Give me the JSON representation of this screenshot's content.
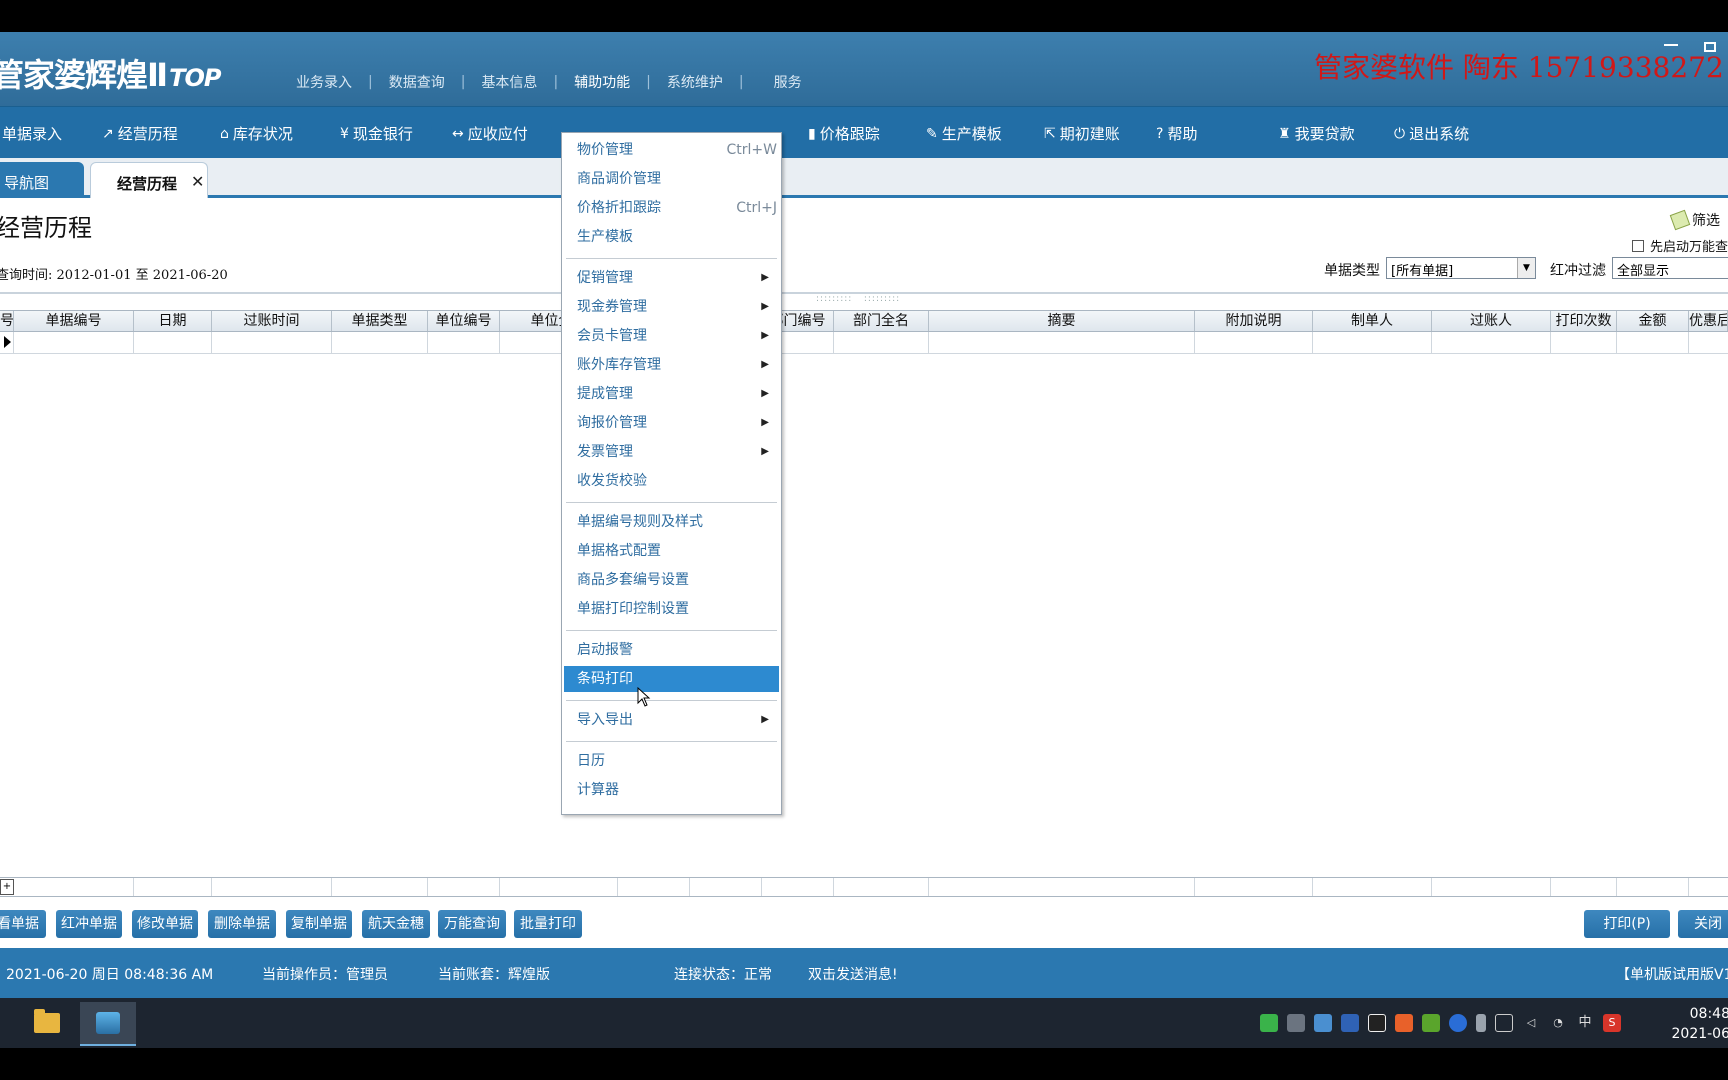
{
  "header": {
    "logo_text": "管家婆",
    "logo_sub": "辉煌Ⅱ",
    "logo_top": "TOP",
    "menu": [
      "业务录入",
      "数据查询",
      "基本信息",
      "辅助功能",
      "系统维护",
      "服务"
    ],
    "brand_contact": "管家婆软件 陶东 15719338272"
  },
  "toolbar": {
    "items": [
      {
        "label": "单据录入",
        "icon": "list-icon"
      },
      {
        "label": "经营历程",
        "icon": "chart-line-icon"
      },
      {
        "label": "库存状况",
        "icon": "home-icon"
      },
      {
        "label": "现金银行",
        "icon": "yen-icon"
      },
      {
        "label": "应收应付",
        "icon": "arrows-icon"
      },
      {
        "label": "价格跟踪",
        "icon": "bar-chart-icon"
      },
      {
        "label": "生产模板",
        "icon": "wrench-icon"
      },
      {
        "label": "期初建账",
        "icon": "external-icon"
      },
      {
        "label": "帮助",
        "icon": "question-icon"
      },
      {
        "label": "我要贷款",
        "icon": "money-bag-icon"
      },
      {
        "label": "退出系统",
        "icon": "power-icon"
      }
    ]
  },
  "tabs": {
    "nav": "导航图",
    "active": "经营历程",
    "close": "✕"
  },
  "content": {
    "title": "经营历程",
    "query_label": "查询时间:",
    "date_from": "2012-01-01",
    "date_to_label": "至",
    "date_to": "2021-06-20",
    "filter": "筛选",
    "auto_check": "先启动万能查",
    "doc_type_label": "单据类型",
    "doc_type_value": "[所有单据]",
    "red_filter_label": "红冲过滤",
    "red_filter_value": "全部显示"
  },
  "grid": {
    "columns": [
      "号",
      "单据编号",
      "日期",
      "过账时间",
      "单据类型",
      "单位编号",
      "单位全名",
      "",
      "",
      "部门编号",
      "部门全名",
      "摘要",
      "附加说明",
      "制单人",
      "过账人",
      "打印次数",
      "金额",
      "优惠后"
    ]
  },
  "buttons": {
    "left": [
      "查看单据",
      "红冲单据",
      "修改单据",
      "删除单据",
      "复制单据",
      "航天金穗",
      "万能查询",
      "批量打印"
    ],
    "print": "打印(P)",
    "close": "关闭"
  },
  "status": {
    "datetime": "2021-06-20 周日 08:48:36 AM",
    "operator": "当前操作员：管理员",
    "account": "当前账套：辉煌版",
    "connection": "连接状态：正常",
    "message": "双击发送消息!",
    "edition": "【单机版试用版V1"
  },
  "taskbar": {
    "time": "08:48",
    "date": "2021-06"
  },
  "dropdown": {
    "groups": [
      [
        {
          "label": "物价管理",
          "shortcut": "Ctrl+W"
        },
        {
          "label": "商品调价管理",
          "shortcut": ""
        },
        {
          "label": "价格折扣跟踪",
          "shortcut": "Ctrl+J"
        },
        {
          "label": "生产模板",
          "shortcut": ""
        }
      ],
      [
        {
          "label": "促销管理",
          "submenu": true
        },
        {
          "label": "现金券管理",
          "submenu": true
        },
        {
          "label": "会员卡管理",
          "submenu": true
        },
        {
          "label": "账外库存管理",
          "submenu": true
        },
        {
          "label": "提成管理",
          "submenu": true
        },
        {
          "label": "询报价管理",
          "submenu": true
        },
        {
          "label": "发票管理",
          "submenu": true
        },
        {
          "label": "收发货校验",
          "submenu": false
        }
      ],
      [
        {
          "label": "单据编号规则及样式"
        },
        {
          "label": "单据格式配置"
        },
        {
          "label": "商品多套编号设置"
        },
        {
          "label": "单据打印控制设置"
        }
      ],
      [
        {
          "label": "启动报警"
        },
        {
          "label": "条码打印",
          "highlighted": true
        }
      ],
      [
        {
          "label": "导入导出",
          "submenu": true
        }
      ],
      [
        {
          "label": "日历"
        },
        {
          "label": "计算器"
        }
      ]
    ],
    "submenu_arrow": "▶"
  },
  "colors": {
    "header_blue": "#2f6c99",
    "toolbar_blue": "#226ea6",
    "accent_blue": "#2b78b0",
    "highlight": "#2d8ad0",
    "brand_red": "#d01818"
  }
}
